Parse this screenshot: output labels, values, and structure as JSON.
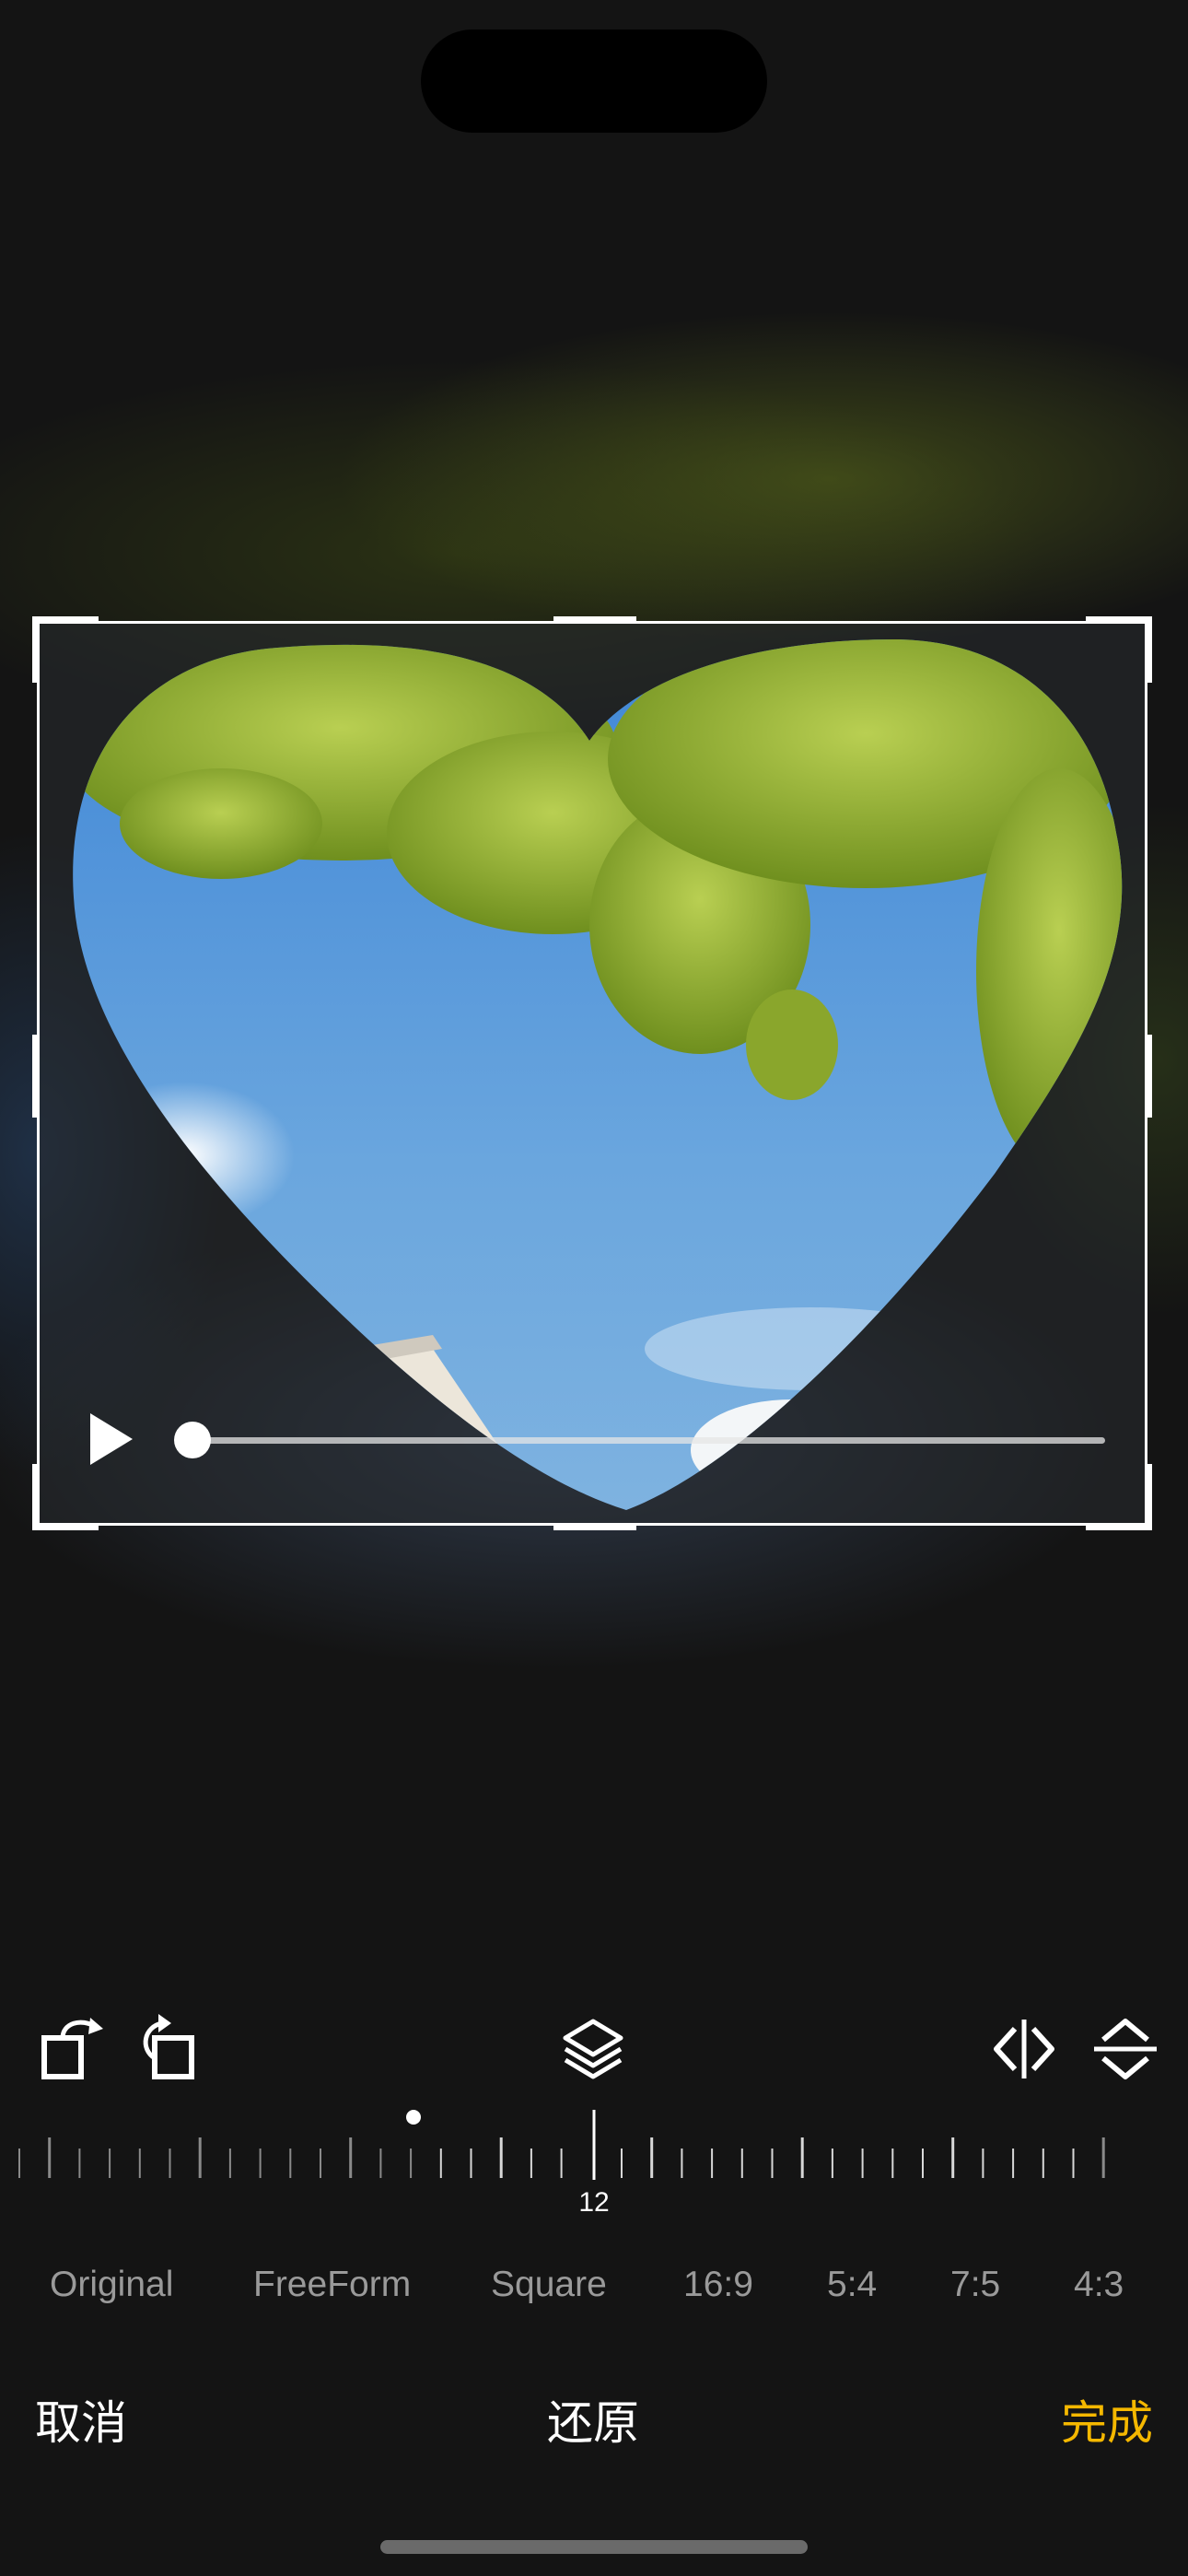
{
  "editor": {
    "video": {
      "state": "paused",
      "progress": 0.0
    },
    "toolbar": {
      "icons": [
        "rotate-left-icon",
        "rotate-right-icon",
        "layers-icon",
        "flip-horizontal-icon",
        "flip-vertical-icon"
      ]
    },
    "rotation_ruler": {
      "value": "12"
    },
    "aspect_ratios": [
      "Original",
      "FreeForm",
      "Square",
      "16:9",
      "5:4",
      "7:5",
      "4:3"
    ],
    "actions": {
      "cancel": "取消",
      "reset": "还原",
      "done": "完成"
    },
    "colors": {
      "accent": "#F5B800",
      "background": "#141414"
    }
  }
}
